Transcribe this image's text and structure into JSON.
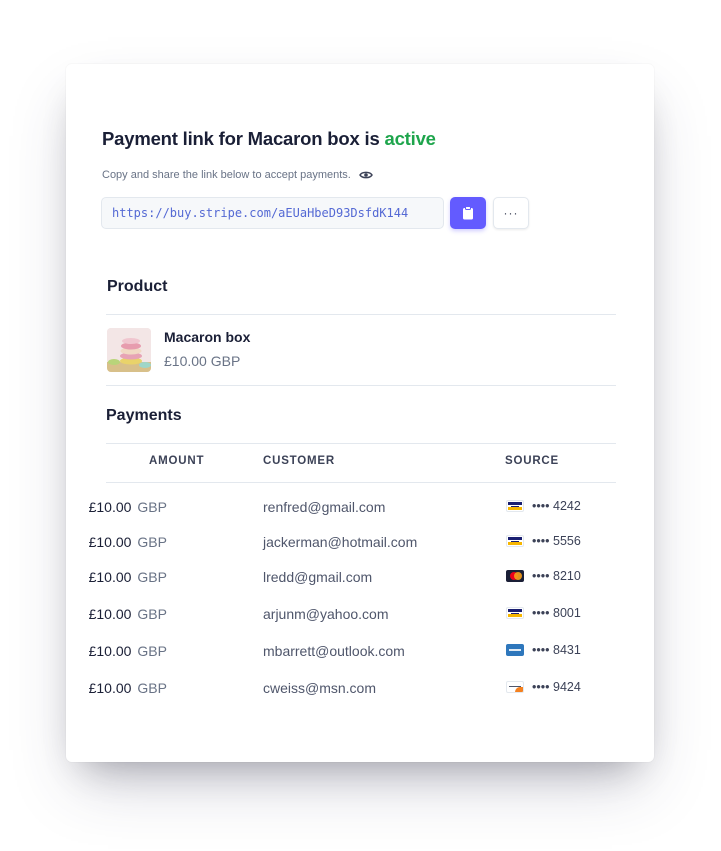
{
  "header": {
    "title_prefix": "Payment link for Macaron box is",
    "title_status": "active",
    "subtitle": "Copy and share the link below to accept payments.",
    "link_url": "https://buy.stripe.com/aEUaHbeD93DsfdK144",
    "more_label": "···",
    "colors": {
      "status": "#1ea54c",
      "accent": "#635bff",
      "link": "#5469d4"
    },
    "icons": {
      "visibility": "eye-icon",
      "copy": "clipboard-icon",
      "more": "ellipsis-icon"
    }
  },
  "product": {
    "heading": "Product",
    "name": "Macaron box",
    "price": "£10.00 GBP",
    "image_icon": "macaron-thumbnail"
  },
  "payments": {
    "heading": "Payments",
    "columns": [
      "AMOUNT",
      "CUSTOMER",
      "SOURCE"
    ],
    "rows": [
      {
        "amount": "£10.00",
        "currency": "GBP",
        "customer": "renfred@gmail.com",
        "card_icon": "visa-card-icon",
        "mask": "••••",
        "last4": "4242"
      },
      {
        "amount": "£10.00",
        "currency": "GBP",
        "customer": "jackerman@hotmail.com",
        "card_icon": "visa-card-icon",
        "mask": "••••",
        "last4": "5556"
      },
      {
        "amount": "£10.00",
        "currency": "GBP",
        "customer": "lredd@gmail.com",
        "card_icon": "mastercard-icon",
        "mask": "••••",
        "last4": "8210"
      },
      {
        "amount": "£10.00",
        "currency": "GBP",
        "customer": "arjunm@yahoo.com",
        "card_icon": "visa-card-icon",
        "mask": "••••",
        "last4": "8001"
      },
      {
        "amount": "£10.00",
        "currency": "GBP",
        "customer": "mbarrett@outlook.com",
        "card_icon": "amex-card-icon",
        "mask": "••••",
        "last4": "8431"
      },
      {
        "amount": "£10.00",
        "currency": "GBP",
        "customer": "cweiss@msn.com",
        "card_icon": "discover-card-icon",
        "mask": "••••",
        "last4": "9424"
      }
    ]
  }
}
